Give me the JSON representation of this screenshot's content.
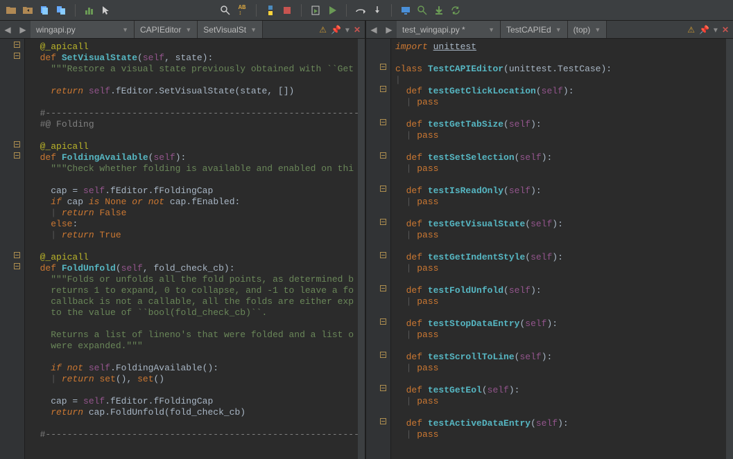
{
  "toolbar": {
    "icons": [
      "open-folder",
      "folder-in",
      "copy-doc",
      "copy-docs",
      "bar-chart",
      "cursor-arrow",
      "search",
      "ab-replace",
      "python",
      "stop",
      "clipboard-play",
      "play",
      "step-over",
      "step-into",
      "monitor",
      "zoom",
      "download",
      "refresh"
    ]
  },
  "left_tabs": {
    "filename": "wingapi.py",
    "crumb1": "CAPIEditor",
    "crumb2": "SetVisualSt"
  },
  "right_tabs": {
    "filename": "test_wingapi.py *",
    "crumb1": "TestCAPIEd",
    "crumb2": "(top)"
  },
  "left_code": {
    "lines": [
      {
        "t": "deco",
        "text": "  @_apicall"
      },
      {
        "t": "def",
        "raw": "  <span class='kw'>def</span> <span class='def'>SetVisualState</span>(<span class='self'>self</span>, state):"
      },
      {
        "t": "str",
        "raw": "    <span class='str'>\"\"\"Restore a visual state previously obtained with ``Get</span>"
      },
      {
        "t": "blank",
        "text": ""
      },
      {
        "t": "ret",
        "raw": "    <span class='kw-italic'>return</span> <span class='self'>self</span>.fEditor.SetVisualState(state, [])"
      },
      {
        "t": "blank",
        "text": ""
      },
      {
        "t": "comment",
        "raw": "  <span class='comment'>#-----------------------------------------------------------------</span>"
      },
      {
        "t": "comment",
        "raw": "  <span class='comment'>#@ Folding</span>"
      },
      {
        "t": "blank",
        "text": ""
      },
      {
        "t": "deco",
        "text": "  @_apicall"
      },
      {
        "t": "def",
        "raw": "  <span class='kw'>def</span> <span class='def'>FoldingAvailable</span>(<span class='self'>self</span>):"
      },
      {
        "t": "str",
        "raw": "    <span class='str'>\"\"\"Check whether folding is available and enabled on thi</span>"
      },
      {
        "t": "blank",
        "text": ""
      },
      {
        "t": "plain",
        "raw": "    cap = <span class='self'>self</span>.fEditor.fFoldingCap"
      },
      {
        "t": "if",
        "raw": "    <span class='kw-italic'>if</span> cap <span class='kw-italic'>is</span> <span class='kw'>None</span> <span class='kw-italic'>or not</span> cap.fEnabled:"
      },
      {
        "t": "ret",
        "raw": "    <span class='pipe'>|</span> <span class='kw-italic'>return</span> <span class='kw'>False</span>"
      },
      {
        "t": "else",
        "raw": "    <span class='kw'>else</span>:"
      },
      {
        "t": "ret",
        "raw": "    <span class='pipe'>|</span> <span class='kw-italic'>return</span> <span class='kw'>True</span>"
      },
      {
        "t": "blank",
        "text": ""
      },
      {
        "t": "deco",
        "text": "  @_apicall"
      },
      {
        "t": "def",
        "raw": "  <span class='kw'>def</span> <span class='def'>FoldUnfold</span>(<span class='self'>self</span>, fold_check_cb):"
      },
      {
        "t": "str",
        "raw": "    <span class='str'>\"\"\"Folds or unfolds all the fold points, as determined b</span>"
      },
      {
        "t": "str",
        "raw": "    <span class='str'>returns 1 to expand, 0 to collapse, and -1 to leave a fo</span>"
      },
      {
        "t": "str",
        "raw": "    <span class='str'>callback is not a callable, all the folds are either exp</span>"
      },
      {
        "t": "str",
        "raw": "    <span class='str'>to the value of ``bool(fold_check_cb)``.</span>"
      },
      {
        "t": "blank",
        "text": ""
      },
      {
        "t": "str",
        "raw": "    <span class='str'>Returns a list of lineno's that were folded and a list o</span>"
      },
      {
        "t": "str",
        "raw": "    <span class='str'>were expanded.\"\"\"</span>"
      },
      {
        "t": "blank",
        "text": ""
      },
      {
        "t": "if",
        "raw": "    <span class='kw-italic'>if not</span> <span class='self'>self</span>.FoldingAvailable():"
      },
      {
        "t": "ret",
        "raw": "    <span class='pipe'>|</span> <span class='kw-italic'>return</span> <span class='kw'>set</span>(), <span class='kw'>set</span>()"
      },
      {
        "t": "blank",
        "text": ""
      },
      {
        "t": "plain",
        "raw": "    cap = <span class='self'>self</span>.fEditor.fFoldingCap"
      },
      {
        "t": "ret",
        "raw": "    <span class='kw-italic'>return</span> cap.FoldUnfold(fold_check_cb)"
      },
      {
        "t": "blank",
        "text": ""
      },
      {
        "t": "comment",
        "raw": "  <span class='comment'>#-----------------------------------------------------------------</span>"
      }
    ],
    "fold_rows": [
      0,
      1,
      9,
      10,
      19,
      20
    ]
  },
  "right_code": {
    "import_line": "import",
    "import_mod": "unittest",
    "class_kw": "class",
    "class_name": "TestCAPIEditor",
    "class_args": "(unittest.TestCase):",
    "tests": [
      "testGetClickLocation",
      "testGetTabSize",
      "testSetSelection",
      "testIsReadOnly",
      "testGetVisualState",
      "testGetIndentStyle",
      "testFoldUnfold",
      "testStopDataEntry",
      "testScrollToLine",
      "testGetEol",
      "testActiveDataEntry"
    ],
    "def_kw": "def",
    "self_kw": "self",
    "pass_kw": "pass"
  }
}
